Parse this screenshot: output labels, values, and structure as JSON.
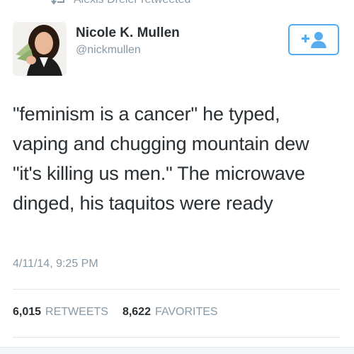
{
  "context": {
    "text": "Alexis Dreier retweeted",
    "icon": "retweet-icon"
  },
  "author": {
    "name": "Nicole K. Mullen",
    "handle": "@nickmullen"
  },
  "follow_button": {
    "icon": "follow-person-plus-icon"
  },
  "tweet": {
    "text": "\"feminism is a cancer\" he typed, vaping and chugging mountain dew \"it's killing us men.\" The microwave dinged, his taquitos were ready",
    "timestamp": "4/11/14, 9:25 PM"
  },
  "stats": {
    "retweets_count": "6,015",
    "retweets_label": "RETWEETS",
    "favorites_count": "8,622",
    "favorites_label": "FAVORITES"
  },
  "colors": {
    "accent": "#55acee",
    "text": "#292f33",
    "muted": "#8899a6",
    "divider": "#e1e8ed"
  }
}
